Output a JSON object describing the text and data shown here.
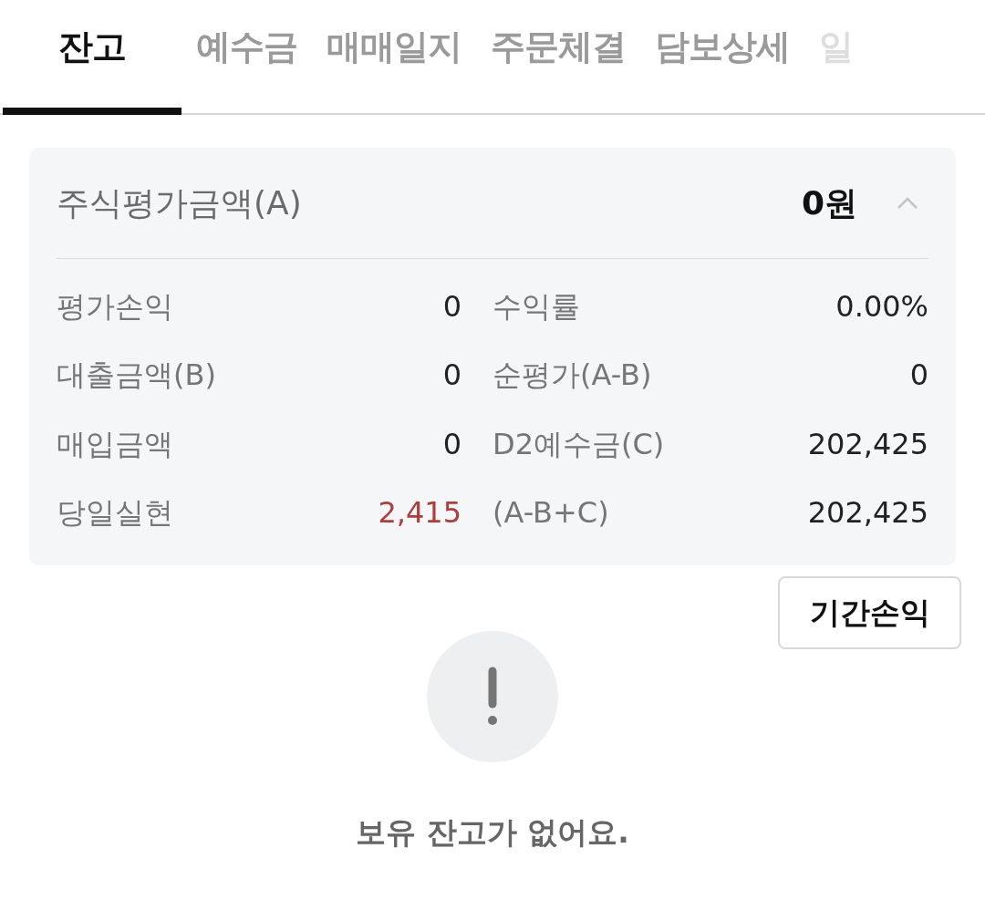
{
  "tabs": [
    {
      "label": "잔고",
      "selected": true
    },
    {
      "label": "예수금",
      "selected": false
    },
    {
      "label": "매매일지",
      "selected": false
    },
    {
      "label": "주문체결",
      "selected": false
    },
    {
      "label": "담보상세",
      "selected": false
    },
    {
      "label": "일",
      "selected": false
    }
  ],
  "summary": {
    "title": "주식평가금액(A)",
    "total": "0원",
    "expanded": true,
    "items": [
      {
        "label": "평가손익",
        "value": "0",
        "color": "#222222"
      },
      {
        "label": "수익률",
        "value": "0.00%",
        "color": "#222222"
      },
      {
        "label": "대출금액(B)",
        "value": "0",
        "color": "#222222"
      },
      {
        "label": "순평가(A-B)",
        "value": "0",
        "color": "#222222"
      },
      {
        "label": "매입금액",
        "value": "0",
        "color": "#222222"
      },
      {
        "label": "D2예수금(C)",
        "value": "202,425",
        "color": "#222222"
      },
      {
        "label": "당일실현",
        "value": "2,415",
        "color": "#b03c3c"
      },
      {
        "label": "(A-B+C)",
        "value": "202,425",
        "color": "#222222"
      }
    ]
  },
  "period_button": "기간손익",
  "empty_message": "보유 잔고가 없어요."
}
